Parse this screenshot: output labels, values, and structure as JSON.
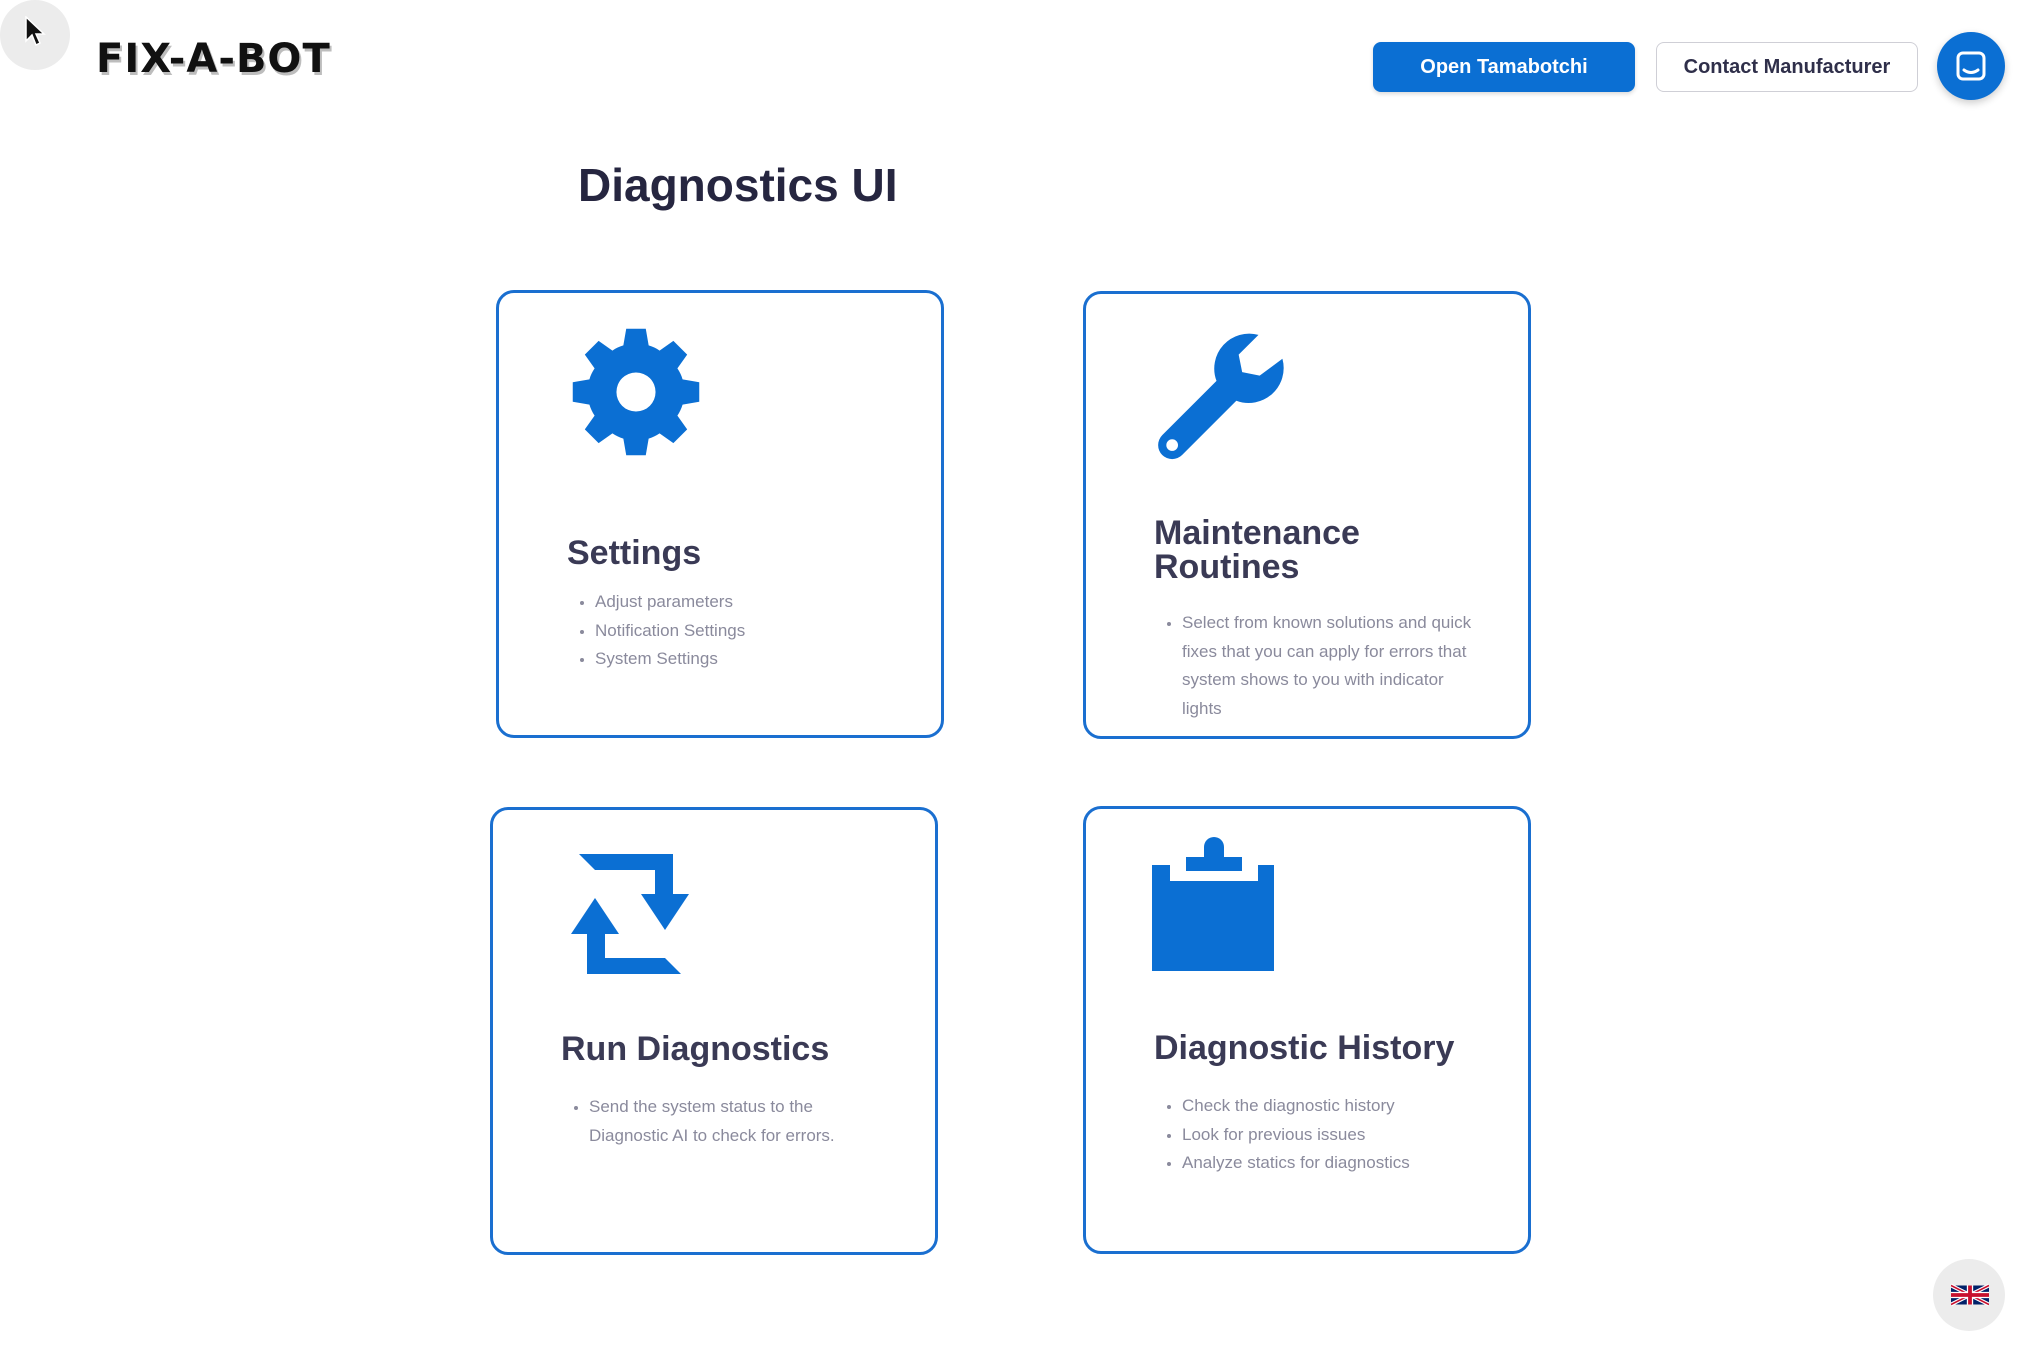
{
  "header": {
    "logo_text": "FIX-A-BOT",
    "primary_button": "Open Tamabotchi",
    "secondary_button": "Contact Manufacturer",
    "chat_icon": "chat-icon"
  },
  "main": {
    "title": "Diagnostics UI",
    "cards": [
      {
        "title": "Settings",
        "icon": "gear-icon",
        "items": [
          "Adjust parameters",
          "Notification Settings",
          "System Settings"
        ]
      },
      {
        "title": "Maintenance Routines",
        "icon": "wrench-icon",
        "items": [
          "Select from known solutions and quick fixes that you can apply for errors that system shows to you with indicator lights"
        ]
      },
      {
        "title": "Run Diagnostics",
        "icon": "refresh-icon",
        "items": [
          "Send the system status to the Diagnostic AI to check for errors."
        ]
      },
      {
        "title": "Diagnostic History",
        "icon": "clipboard-icon",
        "items": [
          "Check the diagnostic history",
          "Look for previous issues",
          "Analyze statics for diagnostics"
        ]
      }
    ]
  },
  "footer": {
    "language_icon": "uk-flag-icon"
  },
  "colors": {
    "accent": "#0b6fd3",
    "card_border": "#1a6fd0",
    "heading": "#3a3a55",
    "muted_text": "#8a8a9c"
  }
}
